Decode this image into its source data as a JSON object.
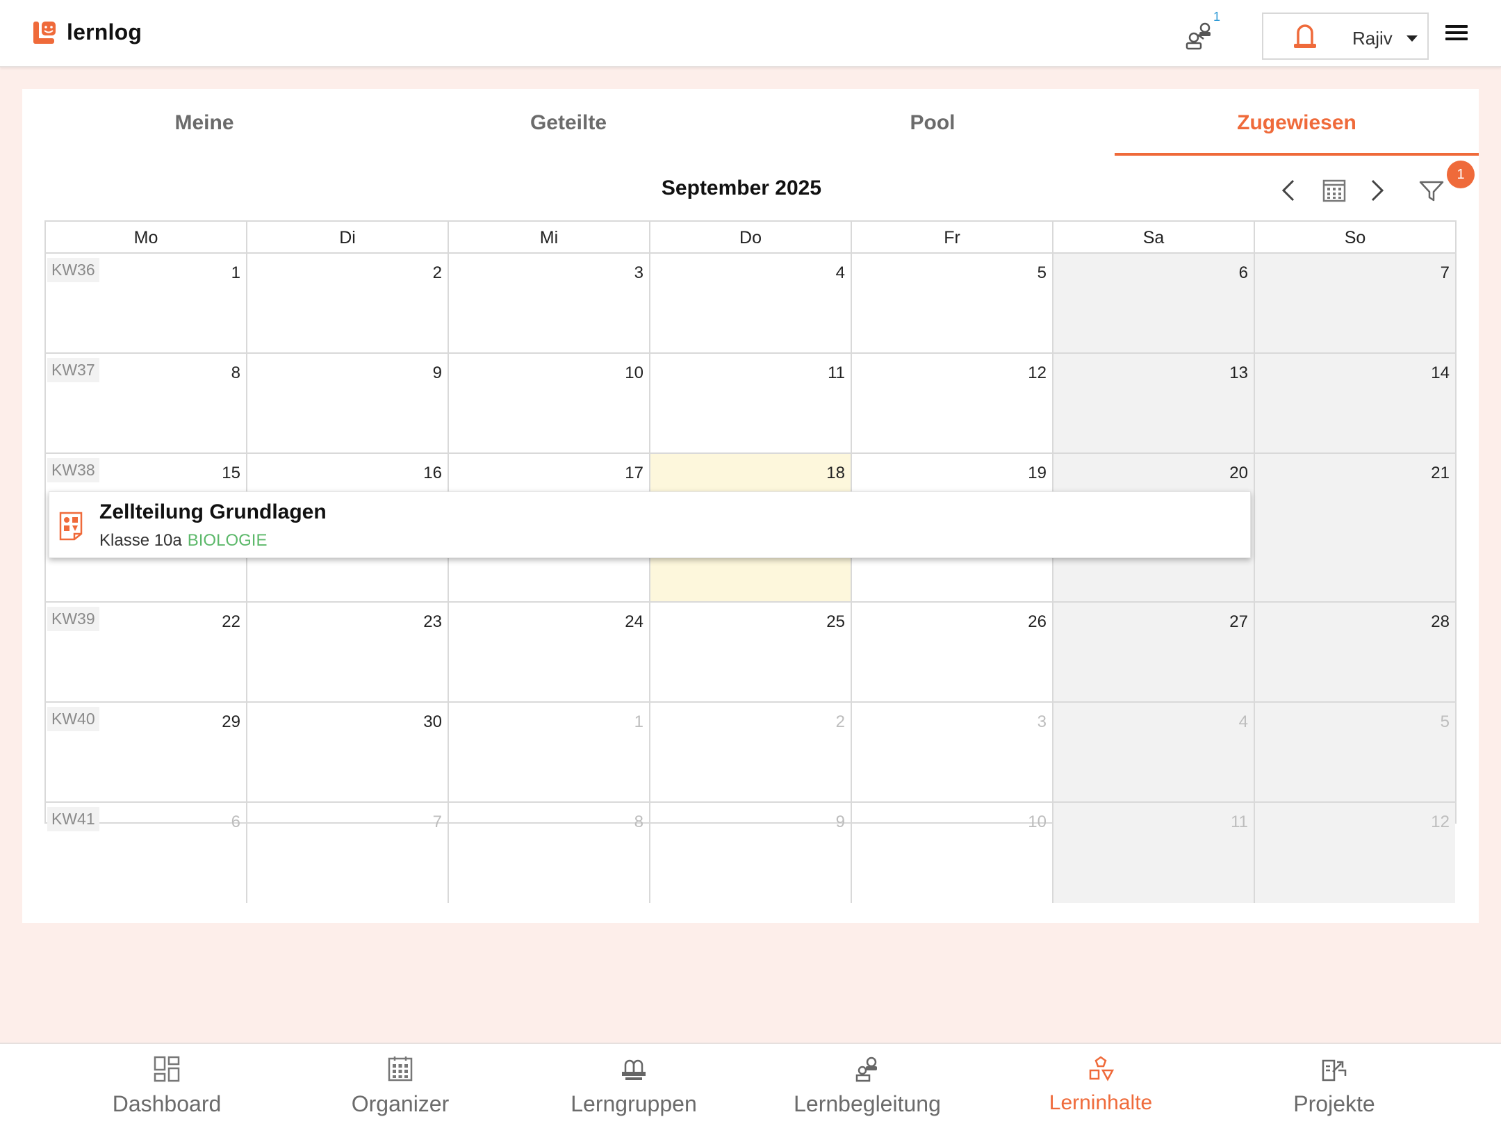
{
  "app": {
    "name": "lernlog",
    "brand_color": "#ef6a3a"
  },
  "header": {
    "notification_count": "1",
    "user_name": "Rajiv"
  },
  "tabs": [
    {
      "label": "Meine",
      "active": false
    },
    {
      "label": "Geteilte",
      "active": false
    },
    {
      "label": "Pool",
      "active": false
    },
    {
      "label": "Zugewiesen",
      "active": true
    }
  ],
  "calendar": {
    "month_title": "September 2025",
    "filter_badge": "1",
    "weekdays": [
      "Mo",
      "Di",
      "Mi",
      "Do",
      "Fr",
      "Sa",
      "So"
    ],
    "weeks": [
      {
        "kw": "KW36",
        "days": [
          {
            "n": "1"
          },
          {
            "n": "2"
          },
          {
            "n": "3"
          },
          {
            "n": "4"
          },
          {
            "n": "5"
          },
          {
            "n": "6"
          },
          {
            "n": "7"
          }
        ]
      },
      {
        "kw": "KW37",
        "days": [
          {
            "n": "8"
          },
          {
            "n": "9"
          },
          {
            "n": "10"
          },
          {
            "n": "11"
          },
          {
            "n": "12"
          },
          {
            "n": "13"
          },
          {
            "n": "14"
          }
        ]
      },
      {
        "kw": "KW38",
        "days": [
          {
            "n": "15"
          },
          {
            "n": "16"
          },
          {
            "n": "17"
          },
          {
            "n": "18",
            "today": true
          },
          {
            "n": "19"
          },
          {
            "n": "20"
          },
          {
            "n": "21"
          }
        ]
      },
      {
        "kw": "KW39",
        "days": [
          {
            "n": "22"
          },
          {
            "n": "23"
          },
          {
            "n": "24"
          },
          {
            "n": "25"
          },
          {
            "n": "26"
          },
          {
            "n": "27"
          },
          {
            "n": "28"
          }
        ]
      },
      {
        "kw": "KW40",
        "days": [
          {
            "n": "29"
          },
          {
            "n": "30"
          },
          {
            "n": "1",
            "other": true
          },
          {
            "n": "2",
            "other": true
          },
          {
            "n": "3",
            "other": true
          },
          {
            "n": "4",
            "other": true
          },
          {
            "n": "5",
            "other": true
          }
        ]
      },
      {
        "kw": "KW41",
        "days": [
          {
            "n": "6",
            "other": true
          },
          {
            "n": "7",
            "other": true
          },
          {
            "n": "8",
            "other": true
          },
          {
            "n": "9",
            "other": true
          },
          {
            "n": "10",
            "other": true
          },
          {
            "n": "11",
            "other": true
          },
          {
            "n": "12",
            "other": true
          }
        ]
      }
    ],
    "event": {
      "title": "Zellteilung Grundlagen",
      "class": "Klasse 10a",
      "subject": "BIOLOGIE",
      "icon": "worksheet-icon"
    }
  },
  "bottom_nav": [
    {
      "label": "Dashboard",
      "icon": "dashboard-icon",
      "active": false
    },
    {
      "label": "Organizer",
      "icon": "calendar-icon",
      "active": false
    },
    {
      "label": "Lerngruppen",
      "icon": "group-icon",
      "active": false
    },
    {
      "label": "Lernbegleitung",
      "icon": "coaching-icon",
      "active": false
    },
    {
      "label": "Lerninhalte",
      "icon": "shapes-icon",
      "active": true
    },
    {
      "label": "Projekte",
      "icon": "project-icon",
      "active": false
    }
  ]
}
